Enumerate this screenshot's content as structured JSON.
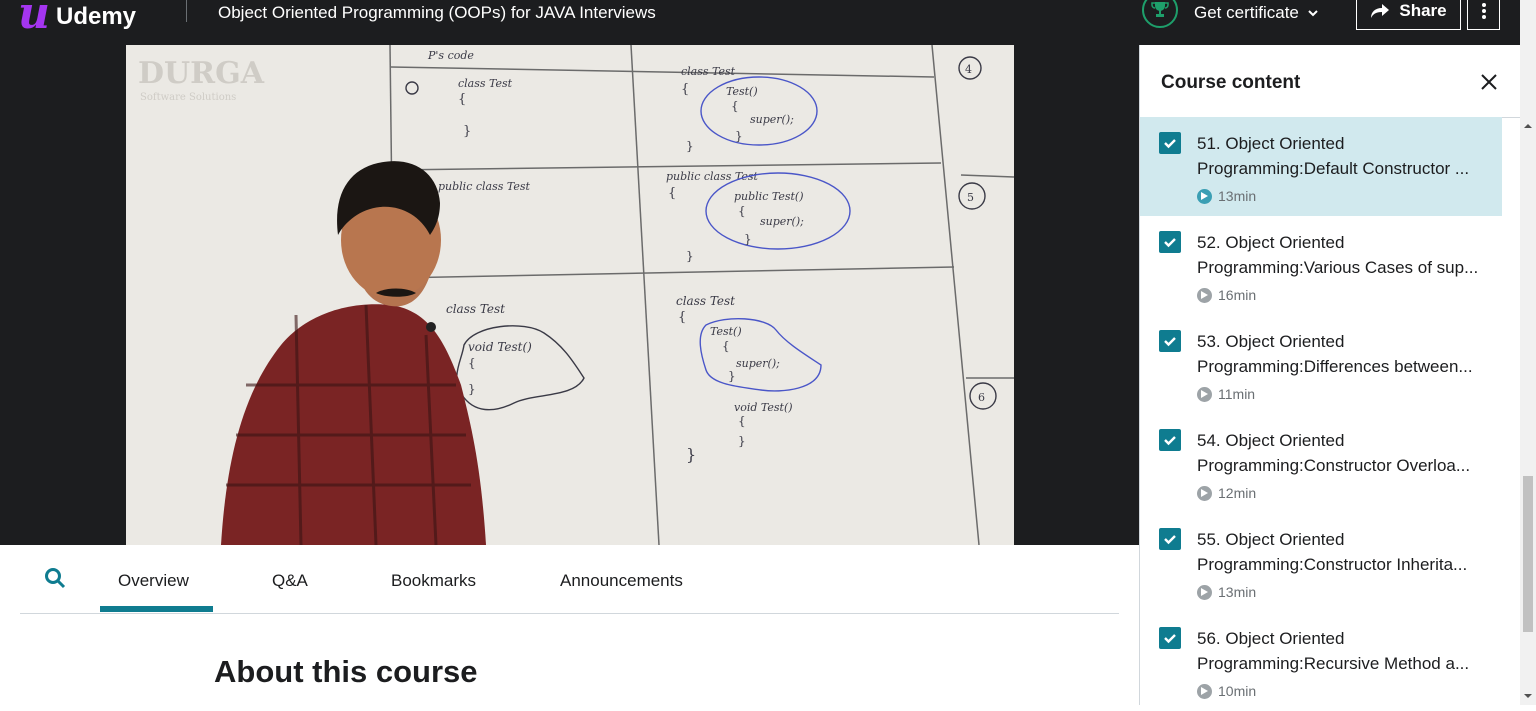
{
  "header": {
    "logo_text": "Udemy",
    "course_title": "Object Oriented Programming (OOPs) for JAVA Interviews",
    "certificate_label": "Get certificate",
    "share_label": "Share"
  },
  "tabs": {
    "items": [
      "Overview",
      "Q&A",
      "Bookmarks",
      "Announcements"
    ],
    "active": "Overview"
  },
  "main": {
    "about_heading": "About this course"
  },
  "sidebar": {
    "title": "Course content",
    "items": [
      {
        "title": "51. Object Oriented\nProgramming:Default Constructor ...",
        "duration": "13min",
        "checked": true,
        "active": true
      },
      {
        "title": "52. Object Oriented\nProgramming:Various Cases of sup...",
        "duration": "16min",
        "checked": true,
        "active": false
      },
      {
        "title": "53. Object Oriented\nProgramming:Differences between...",
        "duration": "11min",
        "checked": true,
        "active": false
      },
      {
        "title": "54. Object Oriented\nProgramming:Constructor Overloa...",
        "duration": "12min",
        "checked": true,
        "active": false
      },
      {
        "title": "55. Object Oriented\nProgramming:Constructor Inherita...",
        "duration": "13min",
        "checked": true,
        "active": false
      },
      {
        "title": "56. Object Oriented\nProgramming:Recursive Method a...",
        "duration": "10min",
        "checked": true,
        "active": false
      }
    ]
  },
  "video": {
    "watermark": "DURGA",
    "watermark_sub": "Software Solutions"
  },
  "colors": {
    "accent": "#0f7c90",
    "brand": "#a435f0",
    "dark": "#1c1d1f"
  }
}
